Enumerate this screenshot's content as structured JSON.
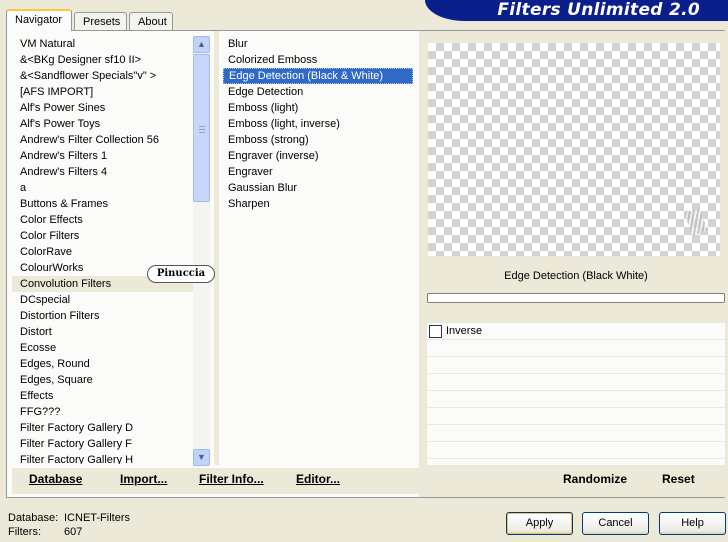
{
  "window": {
    "title": "Filters Unlimited 2.0"
  },
  "tabs": [
    {
      "label": "Navigator"
    },
    {
      "label": "Presets"
    },
    {
      "label": "About"
    }
  ],
  "categories": [
    "VM Natural",
    "&<BKg Designer sf10 II>",
    "&<Sandflower Specials\"v\" >",
    "[AFS IMPORT]",
    "Alf's Power Sines",
    "Alf's Power Toys",
    "Andrew's Filter Collection 56",
    "Andrew's Filters 1",
    "Andrew's Filters 4",
    "a",
    "Buttons & Frames",
    "Color Effects",
    "Color Filters",
    "ColorRave",
    "ColourWorks",
    "Convolution Filters",
    "DCspecial",
    "Distortion Filters",
    "Distort",
    "Ecosse",
    "Edges, Round",
    "Edges, Square",
    "Effects",
    "FFG???",
    "Filter Factory Gallery D",
    "Filter Factory Gallery F",
    "Filter Factory Gallery H"
  ],
  "selected_category": "Convolution Filters",
  "filters": [
    "Blur",
    "Colorized Emboss",
    "Edge Detection (Black & White)",
    "Edge Detection",
    "Emboss (light)",
    "Emboss (light, inverse)",
    "Emboss (strong)",
    "Engraver (inverse)",
    "Engraver",
    "Gaussian Blur",
    "Sharpen"
  ],
  "selected_filter": "Edge Detection (Black & White)",
  "watermark": "Pinuccia",
  "preview": {
    "filter_name": "Edge Detection (Black  White)"
  },
  "controls": {
    "inverse_label": "Inverse",
    "inverse_checked": false
  },
  "panel_buttons": {
    "database": "Database",
    "import": "Import...",
    "filter_info": "Filter Info...",
    "editor": "Editor...",
    "randomize": "Randomize",
    "reset": "Reset"
  },
  "status": {
    "database_label": "Database:",
    "database_value": "ICNET-Filters",
    "filters_label": "Filters:",
    "filters_value": "607"
  },
  "dialog_buttons": {
    "apply": "Apply",
    "cancel": "Cancel",
    "help": "Help"
  },
  "colors": {
    "banner": "#0a1e8c",
    "selection": "#316ac5",
    "face": "#ece9d8"
  }
}
